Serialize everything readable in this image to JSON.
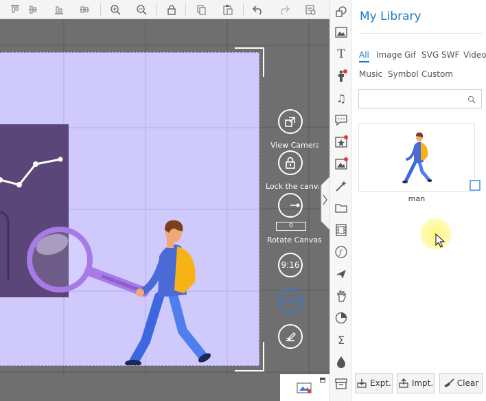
{
  "toolbar": {
    "buttons": [
      {
        "icon": "align-top-icon"
      },
      {
        "icon": "align-middle-icon"
      },
      {
        "icon": "align-bottom-icon"
      },
      {
        "icon": "align-center-icon"
      },
      {
        "icon": "zoom-in-icon"
      },
      {
        "icon": "zoom-out-icon"
      },
      {
        "icon": "lock-icon"
      },
      {
        "icon": "copy-icon"
      },
      {
        "icon": "paste-icon"
      },
      {
        "icon": "undo-icon"
      },
      {
        "icon": "redo-icon"
      },
      {
        "icon": "scene-settings-icon"
      }
    ]
  },
  "camera": {
    "view_camera_label": "View Camera",
    "lock_canvas_label": "Lock the canvas",
    "rotate_value": "0",
    "rotate_canvas_label": "Rotate Canvas",
    "ratio_916": "9:16",
    "ratio_169": "16:9"
  },
  "library": {
    "title": "My Library",
    "tabs": [
      {
        "label": "All",
        "active": true
      },
      {
        "label": "Image"
      },
      {
        "label": "Gif"
      },
      {
        "label": "SVG"
      },
      {
        "label": "SWF"
      },
      {
        "label": "Video"
      },
      {
        "label": "Music"
      },
      {
        "label": "Symbol"
      },
      {
        "label": "Custom"
      }
    ],
    "search_placeholder": "",
    "items": [
      {
        "name": "man"
      }
    ],
    "buttons": {
      "export": "Expt.",
      "import": "Impt.",
      "clear": "Clear"
    }
  },
  "colors": {
    "accent": "#1a7cc7",
    "stage_bg": "#cfc9fc",
    "canvas_bg": "#6f6f6f",
    "panel_purple": "#5a4678",
    "magnifier": "#a77ae6"
  }
}
